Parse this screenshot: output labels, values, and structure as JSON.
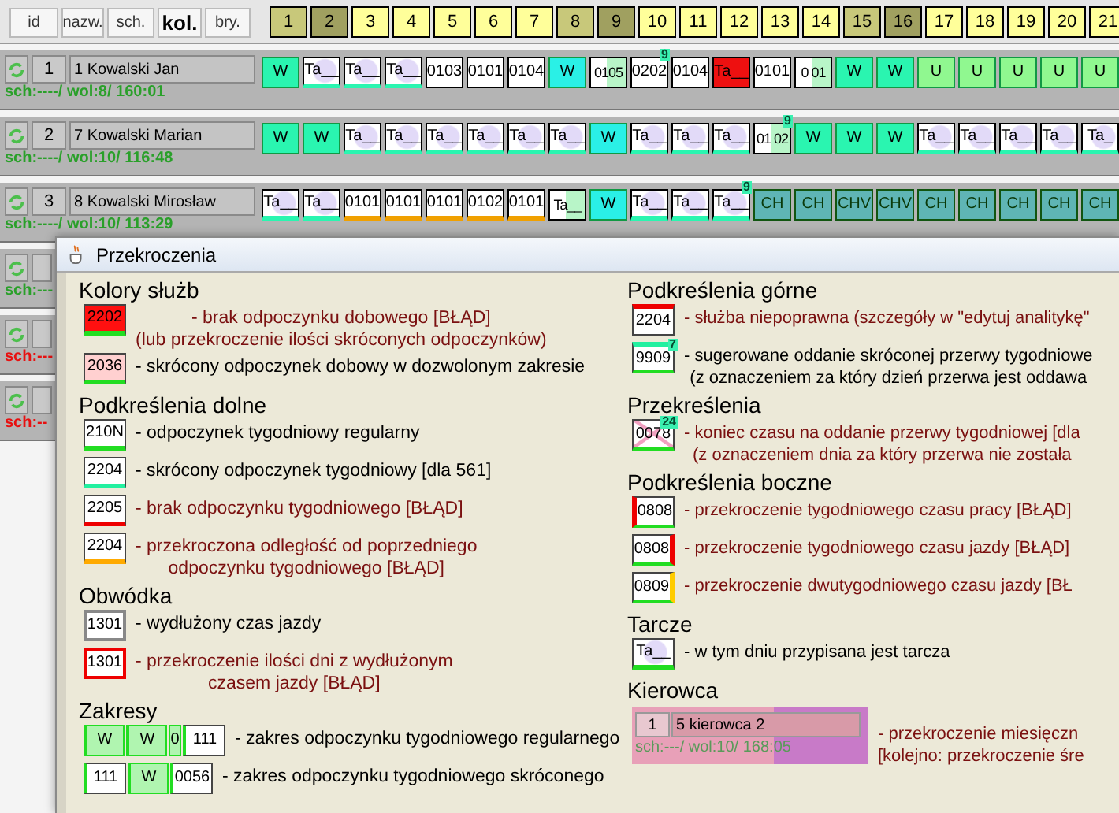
{
  "toolbar": {
    "buttons": [
      {
        "label": "id",
        "selected": false
      },
      {
        "label": "nazw.",
        "selected": false
      },
      {
        "label": "sch.",
        "selected": false
      },
      {
        "label": "kol.",
        "selected": true
      },
      {
        "label": "bry.",
        "selected": false
      }
    ]
  },
  "days": [
    {
      "label": "1",
      "kind": "saturday"
    },
    {
      "label": "2",
      "kind": "sunday"
    },
    {
      "label": "3",
      "kind": "weekday"
    },
    {
      "label": "4",
      "kind": "weekday"
    },
    {
      "label": "5",
      "kind": "weekday"
    },
    {
      "label": "6",
      "kind": "weekday"
    },
    {
      "label": "7",
      "kind": "weekday"
    },
    {
      "label": "8",
      "kind": "saturday"
    },
    {
      "label": "9",
      "kind": "sunday"
    },
    {
      "label": "10",
      "kind": "weekday"
    },
    {
      "label": "11",
      "kind": "weekday"
    },
    {
      "label": "12",
      "kind": "weekday"
    },
    {
      "label": "13",
      "kind": "weekday"
    },
    {
      "label": "14",
      "kind": "weekday"
    },
    {
      "label": "15",
      "kind": "saturday"
    },
    {
      "label": "16",
      "kind": "sunday"
    },
    {
      "label": "17",
      "kind": "weekday"
    },
    {
      "label": "18",
      "kind": "weekday"
    },
    {
      "label": "19",
      "kind": "weekday"
    },
    {
      "label": "20",
      "kind": "weekday"
    },
    {
      "label": "21",
      "kind": "weekday"
    }
  ],
  "drivers": [
    {
      "number": "1",
      "name": "1 Kowalski Jan",
      "stats": "sch:----/ wol:8/ 160:01",
      "warning": false,
      "cells": [
        {
          "text": "W",
          "kind": "rest"
        },
        {
          "text": "Ta__",
          "kind": "disc"
        },
        {
          "text": "Ta__",
          "kind": "disc"
        },
        {
          "text": "Ta__",
          "kind": "disc"
        },
        {
          "text": "0103",
          "kind": "duty"
        },
        {
          "text": "0101",
          "kind": "duty"
        },
        {
          "text": "0104",
          "kind": "duty"
        },
        {
          "text": "W",
          "kind": "rest-cyan"
        },
        {
          "text": "0105",
          "kind": "split"
        },
        {
          "text": "0202",
          "kind": "duty",
          "sup": "9"
        },
        {
          "text": "0104",
          "kind": "duty"
        },
        {
          "text": "Ta__",
          "kind": "error"
        },
        {
          "text": "0101",
          "kind": "duty"
        },
        {
          "text": "0 01",
          "kind": "split"
        },
        {
          "text": "W",
          "kind": "rest"
        },
        {
          "text": "W",
          "kind": "rest"
        },
        {
          "text": "U",
          "kind": "leave"
        },
        {
          "text": "U",
          "kind": "leave"
        },
        {
          "text": "U",
          "kind": "leave"
        },
        {
          "text": "U",
          "kind": "leave"
        },
        {
          "text": "U",
          "kind": "leave"
        }
      ]
    },
    {
      "number": "2",
      "name": "7 Kowalski Marian",
      "stats": "sch:----/ wol:10/ 116:48",
      "warning": false,
      "cells": [
        {
          "text": "W",
          "kind": "rest"
        },
        {
          "text": "W",
          "kind": "rest"
        },
        {
          "text": "Ta__",
          "kind": "disc"
        },
        {
          "text": "Ta__",
          "kind": "disc"
        },
        {
          "text": "Ta__",
          "kind": "disc"
        },
        {
          "text": "Ta__",
          "kind": "disc"
        },
        {
          "text": "Ta__",
          "kind": "disc"
        },
        {
          "text": "Ta__",
          "kind": "disc"
        },
        {
          "text": "W",
          "kind": "rest-cyan"
        },
        {
          "text": "Ta__",
          "kind": "disc"
        },
        {
          "text": "Ta__",
          "kind": "disc"
        },
        {
          "text": "Ta__",
          "kind": "disc"
        },
        {
          "text": "01 02",
          "kind": "split",
          "sup": "9"
        },
        {
          "text": "W",
          "kind": "rest"
        },
        {
          "text": "W",
          "kind": "rest"
        },
        {
          "text": "W",
          "kind": "rest"
        },
        {
          "text": "Ta__",
          "kind": "disc"
        },
        {
          "text": "Ta__",
          "kind": "disc"
        },
        {
          "text": "Ta__",
          "kind": "disc"
        },
        {
          "text": "Ta__",
          "kind": "disc"
        },
        {
          "text": "Ta_",
          "kind": "disc"
        }
      ]
    },
    {
      "number": "3",
      "name": "8 Kowalski Mirosław",
      "stats": "sch:----/ wol:10/ 113:29",
      "warning": false,
      "cells": [
        {
          "text": "Ta__",
          "kind": "disc"
        },
        {
          "text": "Ta__",
          "kind": "disc"
        },
        {
          "text": "0101",
          "kind": "duty-late"
        },
        {
          "text": "0101",
          "kind": "duty-late"
        },
        {
          "text": "0101",
          "kind": "duty-late"
        },
        {
          "text": "0102",
          "kind": "duty-late"
        },
        {
          "text": "0101",
          "kind": "duty-late"
        },
        {
          "text": "Ta__",
          "kind": "split"
        },
        {
          "text": "W",
          "kind": "rest-cyan"
        },
        {
          "text": "Ta__",
          "kind": "disc"
        },
        {
          "text": "Ta__",
          "kind": "disc"
        },
        {
          "text": "Ta__",
          "kind": "disc",
          "sup": "9"
        },
        {
          "text": "CH",
          "kind": "sick"
        },
        {
          "text": "CH",
          "kind": "sick"
        },
        {
          "text": "CHV",
          "kind": "sick"
        },
        {
          "text": "CHV",
          "kind": "sick"
        },
        {
          "text": "CH",
          "kind": "sick"
        },
        {
          "text": "CH",
          "kind": "sick"
        },
        {
          "text": "CH",
          "kind": "sick"
        },
        {
          "text": "CH",
          "kind": "sick"
        },
        {
          "text": "CH",
          "kind": "sick"
        }
      ]
    },
    {
      "stats": "sch:---",
      "warning": false
    },
    {
      "stats": "sch:---",
      "warning": true
    },
    {
      "stats": "sch:--",
      "warning": true
    }
  ],
  "dialog": {
    "title": "Przekroczenia",
    "left": [
      {
        "title": "Kolory służb",
        "items": [
          {
            "swatch": [
              {
                "text": "2202",
                "kind": "red-fill"
              }
            ],
            "error": true,
            "lines": [
              "- brak odpoczynku dobowego [BŁĄD]",
              "(lub przekroczenie ilości skróconych odpoczynków)"
            ]
          },
          {
            "swatch": [
              {
                "text": "2036",
                "kind": "pink-fill"
              }
            ],
            "error": false,
            "lines": [
              "- skrócony odpoczynek dobowy w dozwolonym zakresie"
            ]
          }
        ]
      },
      {
        "title": "Podkreślenia dolne",
        "items": [
          {
            "swatch": [
              {
                "text": "210N",
                "kind": "under-green"
              }
            ],
            "error": false,
            "lines": [
              "- odpoczynek tygodniowy regularny"
            ]
          },
          {
            "swatch": [
              {
                "text": "2204",
                "kind": "under-teal"
              }
            ],
            "error": false,
            "lines": [
              "- skrócony odpoczynek tygodniowy [dla 561]"
            ]
          },
          {
            "swatch": [
              {
                "text": "2205",
                "kind": "under-red"
              }
            ],
            "error": true,
            "lines": [
              "- brak odpoczynku tygodniowego [BŁĄD]"
            ]
          },
          {
            "swatch": [
              {
                "text": "2204",
                "kind": "under-orange"
              }
            ],
            "error": true,
            "lines": [
              "- przekroczona odległość od poprzedniego",
              "odpoczynku tygodniowego [BŁĄD]"
            ]
          }
        ]
      },
      {
        "title": "Obwódka",
        "items": [
          {
            "swatch": [
              {
                "text": "1301",
                "kind": "border-gray"
              }
            ],
            "error": false,
            "lines": [
              "- wydłużony czas jazdy"
            ]
          },
          {
            "swatch": [
              {
                "text": "1301",
                "kind": "border-red"
              }
            ],
            "error": true,
            "lines": [
              "- przekroczenie ilości dni z wydłużonym",
              "czasem jazdy [BŁĄD]"
            ]
          }
        ]
      },
      {
        "title": "Zakresy",
        "items": [
          {
            "swatch": [
              {
                "text": "W",
                "kind": "rest-light"
              },
              {
                "text": "W",
                "kind": "rest-light"
              },
              {
                "text": "0",
                "kind": "narrow"
              },
              {
                "text": "111",
                "kind": "duty"
              }
            ],
            "error": false,
            "lines": [
              "- zakres odpoczynku tygodniowego regularnego"
            ]
          },
          {
            "swatch": [
              {
                "text": "111",
                "kind": "duty"
              },
              {
                "text": "W",
                "kind": "rest-light"
              },
              {
                "text": "0056",
                "kind": "duty"
              }
            ],
            "error": false,
            "lines": [
              "- zakres odpoczynku tygodniowego skróconego"
            ]
          }
        ]
      }
    ],
    "right": [
      {
        "title": "Podkreślenia górne",
        "items": [
          {
            "swatch": [
              {
                "text": "2204",
                "kind": "top-red"
              }
            ],
            "error": true,
            "lines": [
              "- służba niepoprawna (szczegóły w \"edytuj analitykę\""
            ]
          },
          {
            "swatch": [
              {
                "text": "9909",
                "kind": "top-green",
                "sup": "7"
              }
            ],
            "error": false,
            "lines": [
              "- sugerowane oddanie skróconej przerwy tygodniowe",
              "(z oznaczeniem za który dzień przerwa jest oddawa"
            ]
          }
        ]
      },
      {
        "title": "Przekreślenia",
        "items": [
          {
            "swatch": [
              {
                "text": "0078",
                "kind": "crossed",
                "sup": "24"
              }
            ],
            "error": true,
            "lines": [
              "- koniec czasu na oddanie przerwy tygodniowej [dla",
              "(z oznaczeniem dnia za który przerwa nie została"
            ]
          }
        ]
      },
      {
        "title": "Podkreślenia boczne",
        "items": [
          {
            "swatch": [
              {
                "text": "0808",
                "kind": "side-left-red"
              }
            ],
            "error": true,
            "lines": [
              "- przekroczenie tygodniowego czasu pracy [BŁĄD]"
            ]
          },
          {
            "swatch": [
              {
                "text": "0808",
                "kind": "side-right-red"
              }
            ],
            "error": true,
            "lines": [
              "- przekroczenie tygodniowego czasu jazdy [BŁĄD]"
            ]
          },
          {
            "swatch": [
              {
                "text": "0809",
                "kind": "side-right-orange"
              }
            ],
            "error": true,
            "lines": [
              "- przekroczenie dwutygodniowego czasu jazdy [BŁ"
            ]
          }
        ]
      },
      {
        "title": "Tarcze",
        "items": [
          {
            "swatch": [
              {
                "text": "Ta__",
                "kind": "disc"
              }
            ],
            "error": false,
            "lines": [
              "- w tym dniu przypisana jest tarcza"
            ]
          }
        ]
      },
      {
        "title": "Kierowca",
        "items": [
          {
            "driver": {
              "number": "1",
              "name": "5 kierowca 2",
              "stats": "sch:---/ wol:10/ 168:05"
            },
            "error": true,
            "lines": [
              "- przekroczenie miesięczn",
              "[kolejno: przekroczenie śre"
            ]
          }
        ]
      }
    ]
  }
}
